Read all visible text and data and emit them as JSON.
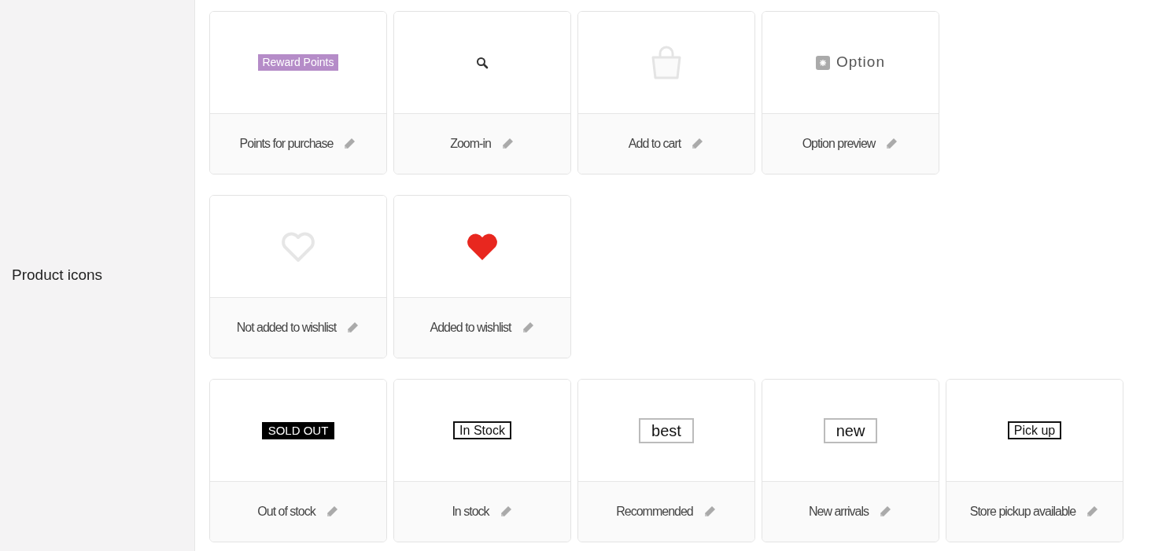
{
  "section": {
    "label": "Product icons"
  },
  "groups": [
    {
      "tiles": [
        {
          "label": "Points for purchase",
          "preview": {
            "kind": "tag",
            "text": "Reward Points"
          }
        },
        {
          "label": "Zoom-in",
          "preview": {
            "kind": "search"
          }
        },
        {
          "label": "Add to cart",
          "preview": {
            "kind": "bag"
          }
        },
        {
          "label": "Option preview",
          "preview": {
            "kind": "option",
            "text": "Option"
          }
        }
      ]
    },
    {
      "tiles": [
        {
          "label": "Not added to wishlist",
          "preview": {
            "kind": "heart-empty"
          }
        },
        {
          "label": "Added to wishlist",
          "preview": {
            "kind": "heart-full"
          }
        }
      ]
    },
    {
      "tiles": [
        {
          "label": "Out of stock",
          "preview": {
            "kind": "inverse",
            "text": "SOLD OUT"
          }
        },
        {
          "label": "In stock",
          "preview": {
            "kind": "stamp",
            "text": "In Stock"
          }
        },
        {
          "label": "Recommended",
          "preview": {
            "kind": "box",
            "text": "best"
          }
        },
        {
          "label": "New arrivals",
          "preview": {
            "kind": "box",
            "text": "new"
          }
        },
        {
          "label": "Store pickup available",
          "preview": {
            "kind": "stamp",
            "text": "Pick up"
          }
        }
      ]
    }
  ]
}
